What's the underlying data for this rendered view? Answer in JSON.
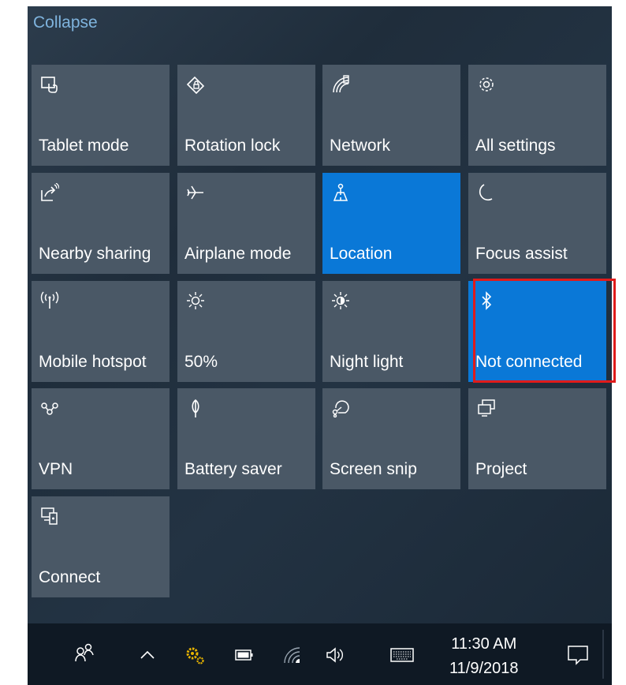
{
  "header": {
    "collapse_label": "Collapse"
  },
  "tiles": [
    {
      "label": "Tablet mode",
      "icon": "tablet-mode-icon",
      "active": false
    },
    {
      "label": "Rotation lock",
      "icon": "rotation-lock-icon",
      "active": false
    },
    {
      "label": "Network",
      "icon": "network-icon",
      "active": false
    },
    {
      "label": "All settings",
      "icon": "gear-icon",
      "active": false
    },
    {
      "label": "Nearby sharing",
      "icon": "nearby-sharing-icon",
      "active": false
    },
    {
      "label": "Airplane mode",
      "icon": "airplane-icon",
      "active": false
    },
    {
      "label": "Location",
      "icon": "location-icon",
      "active": true
    },
    {
      "label": "Focus assist",
      "icon": "moon-icon",
      "active": false
    },
    {
      "label": "Mobile hotspot",
      "icon": "hotspot-icon",
      "active": false
    },
    {
      "label": "50%",
      "icon": "brightness-icon",
      "active": false
    },
    {
      "label": "Night light",
      "icon": "night-light-icon",
      "active": false
    },
    {
      "label": "Not connected",
      "icon": "bluetooth-icon",
      "active": true
    },
    {
      "label": "VPN",
      "icon": "vpn-icon",
      "active": false
    },
    {
      "label": "Battery saver",
      "icon": "battery-saver-icon",
      "active": false
    },
    {
      "label": "Screen snip",
      "icon": "screen-snip-icon",
      "active": false
    },
    {
      "label": "Project",
      "icon": "project-icon",
      "active": false
    },
    {
      "label": "Connect",
      "icon": "connect-icon",
      "active": false
    }
  ],
  "taskbar": {
    "icons": [
      "people-icon",
      "chevron-up-icon",
      "settings-tray-icon",
      "battery-icon",
      "wifi-icon",
      "volume-icon",
      "keyboard-icon",
      "notification-icon"
    ],
    "time": "11:30 AM",
    "date": "11/9/2018"
  },
  "colors": {
    "active_tile": "#0a78d7",
    "inactive_tile": "#4a5866",
    "highlight_border": "#e01b1b"
  }
}
